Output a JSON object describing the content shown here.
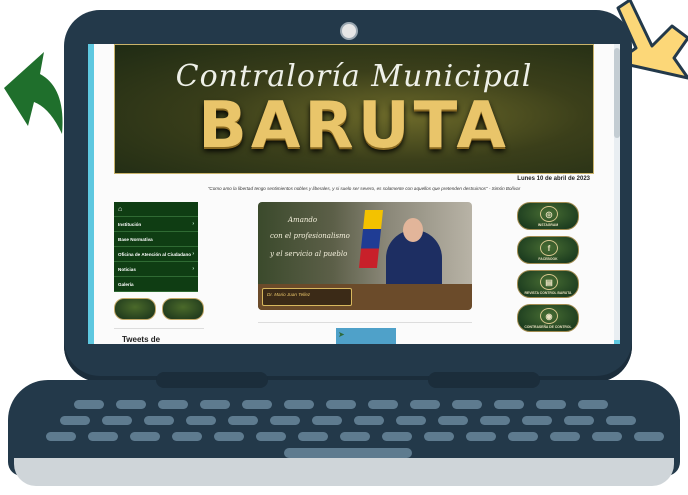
{
  "website": {
    "banner_script": "Contraloría Municipal",
    "banner_title": "BARUTA",
    "date": "Lunes 10 de abril de 2023",
    "quote": "\"Como amo la libertad tengo sentimientos nobles y liberales, y si suelo ser severo, es solamente con aquellos que pretenden destruirnos\" - Simón Bolívar",
    "menu": [
      {
        "label": "Institución",
        "has_submenu": true
      },
      {
        "label": "Base Normativa",
        "has_submenu": false
      },
      {
        "label": "Oficina de Atención al Ciudadano",
        "has_submenu": true
      },
      {
        "label": "Noticias",
        "has_submenu": true
      },
      {
        "label": "Galería",
        "has_submenu": false
      }
    ],
    "tweets_heading": "Tweets de",
    "photo": {
      "line1": "Amando",
      "line2": "con el profesionalismo",
      "line3": "y el servicio al pueblo",
      "nameplate": "Dr. Mario Juan Tellez"
    },
    "social": [
      {
        "label": "INSTAGRAM",
        "icon": "instagram-icon",
        "glyph": "◎"
      },
      {
        "label": "FACEBOOK",
        "icon": "facebook-icon",
        "glyph": "f"
      },
      {
        "label": "REVISTA CONTROL BARUTA",
        "icon": "magazine-icon",
        "glyph": "▤"
      },
      {
        "label": "CONTRASEÑA DE CONTROL",
        "icon": "key-icon",
        "glyph": "◉"
      }
    ]
  },
  "colors": {
    "laptop": "#23394a",
    "screen_frame": "#5ec8e0",
    "menu_bg": "#0f3d13",
    "gold": "#e9c56a",
    "green_arrow": "#1f6f2c",
    "yellow_arrow": "#fcd778"
  }
}
